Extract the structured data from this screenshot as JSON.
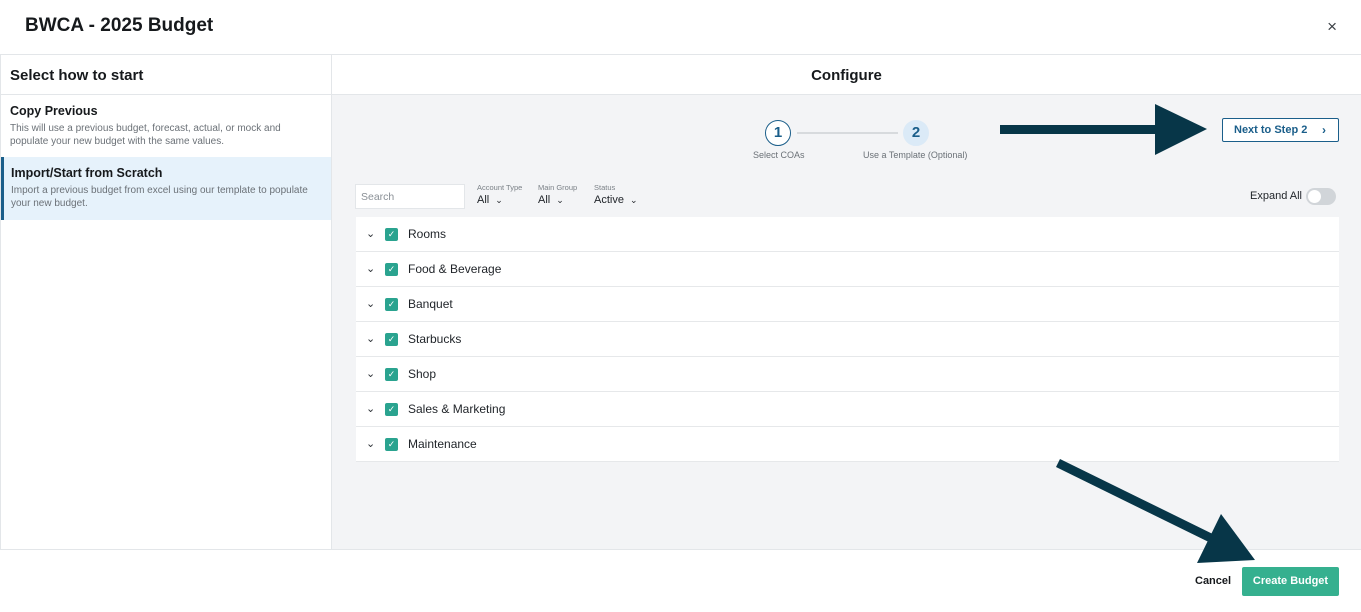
{
  "modal": {
    "title": "BWCA - 2025 Budget",
    "close_label": "×"
  },
  "left": {
    "heading": "Select how to start",
    "options": [
      {
        "title": "Copy Previous",
        "description": "This will use a previous budget, forecast, actual, or mock and populate your new budget with the same values."
      },
      {
        "title": "Import/Start from Scratch",
        "description": "Import a previous budget from excel using our template to populate your new budget."
      }
    ]
  },
  "right": {
    "heading": "Configure",
    "steps": [
      {
        "number": "1",
        "label": "Select COAs"
      },
      {
        "number": "2",
        "label": "Use a Template (Optional)"
      }
    ],
    "next_label": "Next to Step 2",
    "search": {
      "placeholder": "Search",
      "value": ""
    },
    "filters": [
      {
        "label": "Account Type",
        "value": "All"
      },
      {
        "label": "Main Group",
        "value": "All"
      },
      {
        "label": "Status",
        "value": "Active"
      }
    ],
    "expand_all_label": "Expand All",
    "expand_all_on": false,
    "items": [
      {
        "label": "Rooms",
        "checked": true
      },
      {
        "label": "Food & Beverage",
        "checked": true
      },
      {
        "label": "Banquet",
        "checked": true
      },
      {
        "label": "Starbucks",
        "checked": true
      },
      {
        "label": "Shop",
        "checked": true
      },
      {
        "label": "Sales & Marketing",
        "checked": true
      },
      {
        "label": "Maintenance",
        "checked": true
      }
    ]
  },
  "footer": {
    "cancel_label": "Cancel",
    "create_label": "Create Budget"
  },
  "colors": {
    "accent": "#1a5e8a",
    "primary_button": "#35b08f",
    "checkbox": "#2aa38f",
    "annotation_arrow": "#073648"
  }
}
